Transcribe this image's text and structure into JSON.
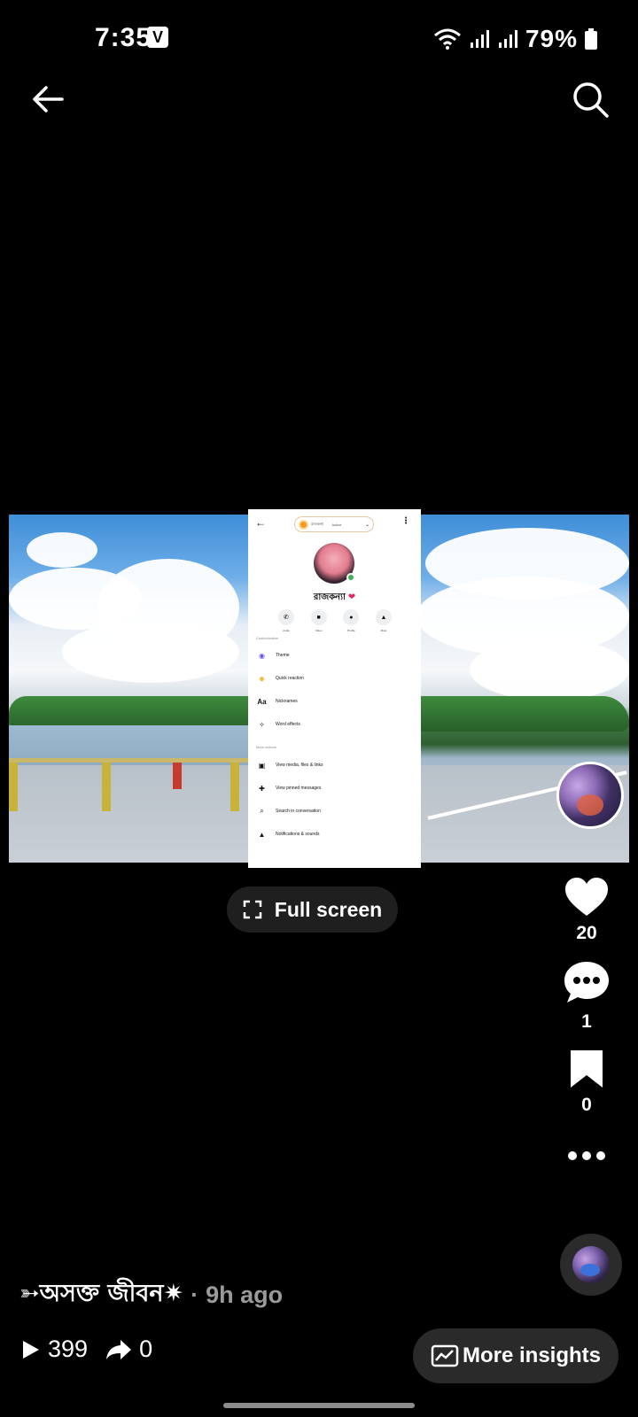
{
  "status_bar": {
    "time": "7:35",
    "app_badge": "V",
    "battery": "79%"
  },
  "video": {
    "overlay": {
      "header_name": "রাজকন্যা",
      "header_status": "Active",
      "profile_name": "রাজকন্যা",
      "actions": [
        "Audio",
        "Video",
        "Profile",
        "Mute"
      ],
      "section_customization": "Customization",
      "customization_items": [
        "Theme",
        "Quick reaction",
        "Nicknames",
        "Word effects"
      ],
      "section_more_actions": "More actions",
      "more_items": [
        "View media, files & links",
        "View pinned messages",
        "Search in conversation",
        "Notifications & sounds"
      ]
    }
  },
  "full_screen_label": "Full screen",
  "side_actions": {
    "likes": "20",
    "comments": "1",
    "saves": "0"
  },
  "caption": {
    "author": "➳অসক্ত জীবন✷",
    "separator": "·",
    "time": "9h ago"
  },
  "stats": {
    "views": "399",
    "shares": "0"
  },
  "insights_label": "More insights",
  "colors": {
    "background": "#000000",
    "pill": "#1f1f1f",
    "muted_text": "#9a9a9a"
  }
}
